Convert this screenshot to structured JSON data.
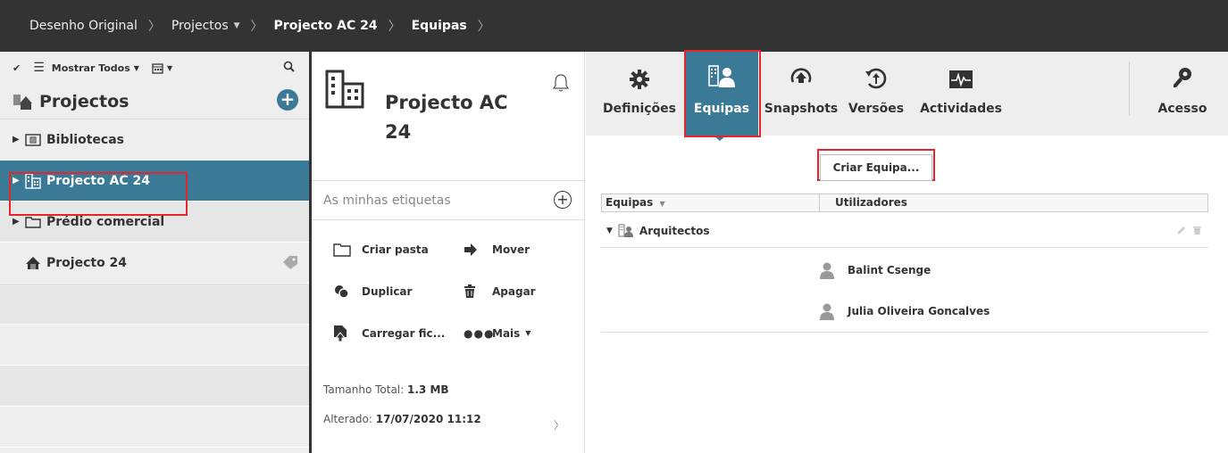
{
  "breadcrumb": {
    "items": [
      "Desenho Original",
      "Projectos",
      "Projecto AC 24",
      "Equipas"
    ]
  },
  "left_panel": {
    "toolbar": {
      "filter_label": "Mostrar Todos"
    },
    "title": "Projectos",
    "tree": [
      {
        "label": "Bibliotecas",
        "icon": "library-folder-icon"
      },
      {
        "label": "Projecto AC 24",
        "icon": "project-building-icon",
        "selected": true
      },
      {
        "label": "Prédio comercial",
        "icon": "folder-icon"
      },
      {
        "label": "Projecto 24",
        "icon": "project-icon"
      }
    ]
  },
  "middle_panel": {
    "project_name_line1": "Projecto AC",
    "project_name_line2": "24",
    "tags_placeholder": "As minhas etiquetas",
    "actions": {
      "create_folder": "Criar pasta",
      "move": "Mover",
      "duplicate": "Duplicar",
      "delete": "Apagar",
      "upload": "Carregar fic...",
      "more": "Mais"
    },
    "total_size_label": "Tamanho Total:",
    "total_size_value": "1.3 MB",
    "modified_label": "Alterado:",
    "modified_value": "17/07/2020 11:12"
  },
  "right_panel": {
    "tabs": {
      "settings": "Definições",
      "teams": "Equipas",
      "snapshots": "Snapshots",
      "versions": "Versões",
      "activities": "Actividades",
      "access": "Acesso"
    },
    "create_team_button": "Criar Equipa...",
    "grid": {
      "col_teams": "Equipas",
      "col_users": "Utilizadores"
    },
    "team": {
      "name": "Arquitectos",
      "users": [
        "Balint Csenge",
        "Julia Oliveira Goncalves"
      ]
    }
  },
  "colors": {
    "accent": "#3b7a96",
    "highlight_outline": "#e3262c",
    "topbar": "#333333"
  }
}
